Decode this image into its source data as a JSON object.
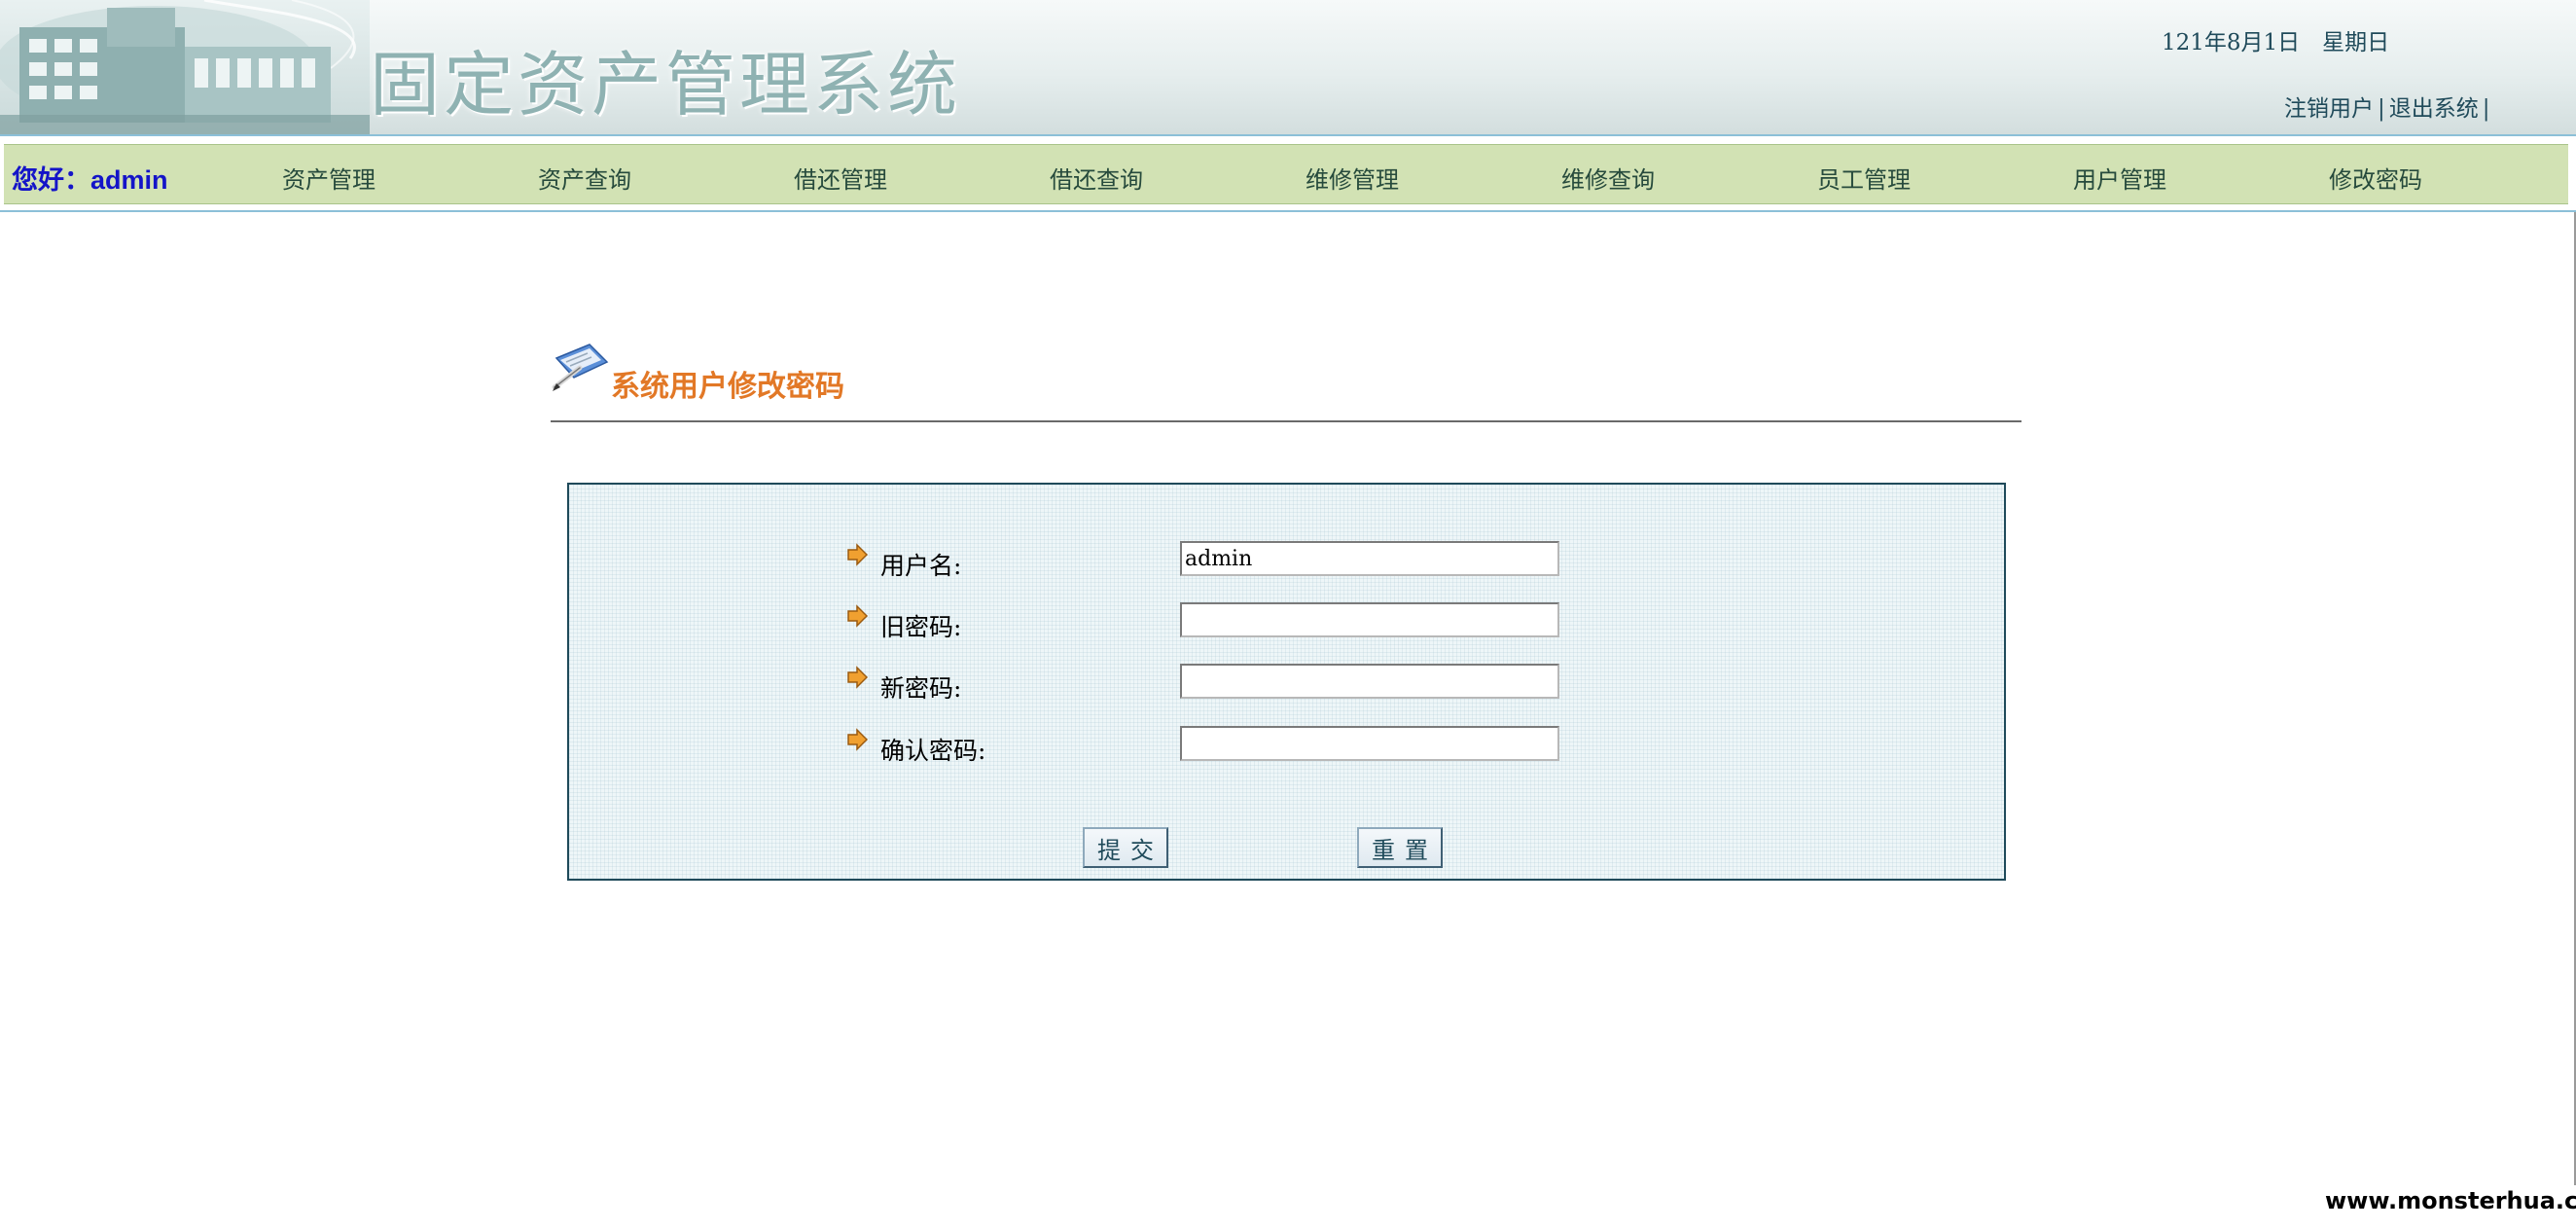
{
  "header": {
    "title": "固定资产管理系统",
    "date_text": "121年8月1日　星期日",
    "logout_user_link": "注销用户",
    "exit_system_link": "退出系统",
    "separator": "|"
  },
  "nav": {
    "greeting": "您好：admin",
    "items": [
      {
        "label": "资产管理"
      },
      {
        "label": "资产查询"
      },
      {
        "label": "借还管理"
      },
      {
        "label": "借还查询"
      },
      {
        "label": "维修管理"
      },
      {
        "label": "维修查询"
      },
      {
        "label": "员工管理"
      },
      {
        "label": "用户管理"
      },
      {
        "label": "修改密码"
      }
    ]
  },
  "page": {
    "heading": "系统用户修改密码",
    "heading_icon": "document-edit-icon",
    "heading_color": "#e27826"
  },
  "form": {
    "fields": [
      {
        "label": "用户名:",
        "value": "admin"
      },
      {
        "label": "旧密码:",
        "value": ""
      },
      {
        "label": "新密码:",
        "value": ""
      },
      {
        "label": "确认密码:",
        "value": ""
      }
    ],
    "submit_label": "提交",
    "reset_label": "重置"
  },
  "watermark": "www.monsterhua.com",
  "colors": {
    "nav_bg": "#d2e2b4",
    "greeting": "#1414c8",
    "panel_border": "#1f4a5a",
    "arrow": "#f0a030"
  }
}
